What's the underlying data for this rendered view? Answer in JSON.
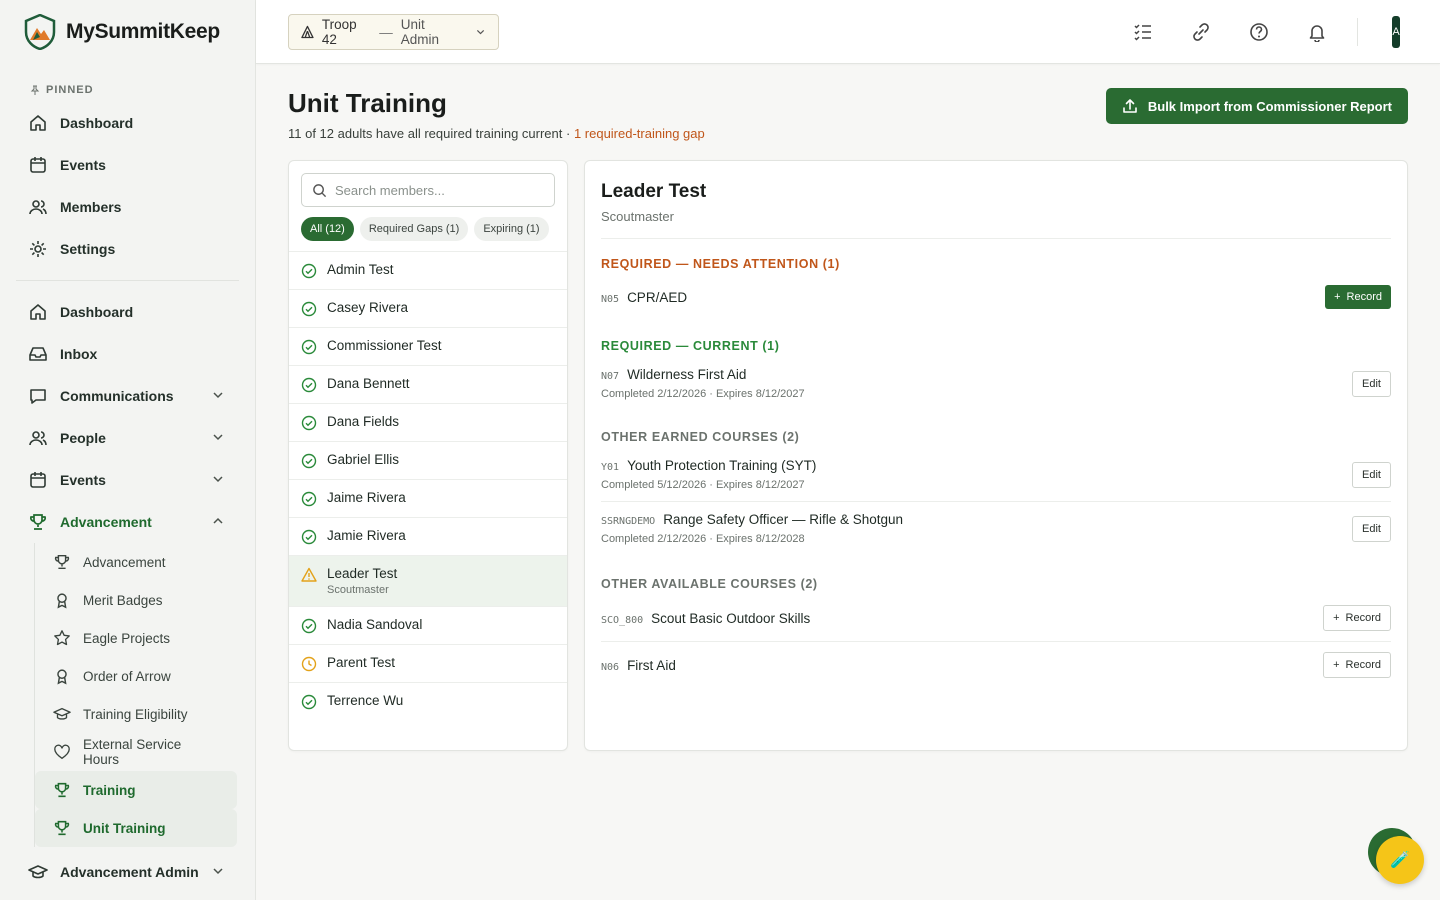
{
  "app": {
    "name": "MySummitKeep"
  },
  "sidebar": {
    "pinned_label": "PINNED",
    "pinned": [
      {
        "label": "Dashboard",
        "icon": "home-icon"
      },
      {
        "label": "Events",
        "icon": "calendar-icon"
      },
      {
        "label": "Members",
        "icon": "people-icon"
      },
      {
        "label": "Settings",
        "icon": "gear-icon"
      }
    ],
    "main": [
      {
        "label": "Dashboard",
        "icon": "home-icon"
      },
      {
        "label": "Inbox",
        "icon": "inbox-icon"
      },
      {
        "label": "Communications",
        "icon": "chat-icon"
      },
      {
        "label": "People",
        "icon": "people-icon"
      },
      {
        "label": "Events",
        "icon": "calendar-icon"
      },
      {
        "label": "Advancement",
        "icon": "trophy-icon"
      }
    ],
    "advancement_sub": [
      {
        "label": "Advancement",
        "icon": "trophy-icon"
      },
      {
        "label": "Merit Badges",
        "icon": "badge-icon"
      },
      {
        "label": "Eagle Projects",
        "icon": "star-icon"
      },
      {
        "label": "Order of Arrow",
        "icon": "badge-icon"
      },
      {
        "label": "Training Eligibility",
        "icon": "grad-cap-icon"
      },
      {
        "label": "External Service Hours",
        "icon": "heart-icon"
      },
      {
        "label": "Training",
        "icon": "trophy-icon"
      },
      {
        "label": "Unit Training",
        "icon": "trophy-icon"
      }
    ],
    "advancement_admin": "Advancement Admin"
  },
  "topbar": {
    "unit": "Troop 42",
    "sep": "—",
    "role": "Unit Admin",
    "avatar": "A"
  },
  "page": {
    "title": "Unit Training",
    "subtitle": "11 of 12 adults have all required training current ·",
    "gap_text": "1 required-training gap",
    "bulk_button": "Bulk Import from Commissioner Report"
  },
  "members": {
    "search_placeholder": "Search members...",
    "chips": [
      "All (12)",
      "Required Gaps (1)",
      "Expiring (1)"
    ],
    "list": [
      {
        "name": "Admin Test",
        "status": "ok"
      },
      {
        "name": "Casey Rivera",
        "status": "ok"
      },
      {
        "name": "Commissioner Test",
        "status": "ok"
      },
      {
        "name": "Dana Bennett",
        "status": "ok"
      },
      {
        "name": "Dana Fields",
        "status": "ok"
      },
      {
        "name": "Gabriel Ellis",
        "status": "ok"
      },
      {
        "name": "Jaime Rivera",
        "status": "ok"
      },
      {
        "name": "Jamie Rivera",
        "status": "ok"
      },
      {
        "name": "Leader Test",
        "role": "Scoutmaster",
        "status": "warn"
      },
      {
        "name": "Nadia Sandoval",
        "status": "ok"
      },
      {
        "name": "Parent Test",
        "status": "expiring"
      },
      {
        "name": "Terrence Wu",
        "status": "ok"
      }
    ]
  },
  "detail": {
    "name": "Leader Test",
    "role": "Scoutmaster",
    "sections": {
      "attention": {
        "heading": "REQUIRED — NEEDS ATTENTION (1)",
        "courses": [
          {
            "code": "N05",
            "title": "CPR/AED",
            "action": "Record"
          }
        ]
      },
      "current": {
        "heading": "REQUIRED — CURRENT (1)",
        "courses": [
          {
            "code": "N07",
            "title": "Wilderness First Aid",
            "meta": "Completed 2/12/2026 · Expires 8/12/2027",
            "action": "Edit"
          }
        ]
      },
      "earned": {
        "heading": "OTHER EARNED COURSES (2)",
        "courses": [
          {
            "code": "Y01",
            "title": "Youth Protection Training (SYT)",
            "meta": "Completed 5/12/2026 · Expires 8/12/2027",
            "action": "Edit"
          },
          {
            "code": "SSRNGDEMO",
            "title": "Range Safety Officer — Rifle & Shotgun",
            "meta": "Completed 2/12/2026 · Expires 8/12/2028",
            "action": "Edit"
          }
        ]
      },
      "available": {
        "heading": "OTHER AVAILABLE COURSES (2)",
        "courses": [
          {
            "code": "SCO_800",
            "title": "Scout Basic Outdoor Skills",
            "action": "Record"
          },
          {
            "code": "N06",
            "title": "First Aid",
            "action": "Record"
          }
        ]
      }
    }
  },
  "colors": {
    "brand_green": "#2a6b32",
    "warn_orange": "#c0561a",
    "ok_green": "#2a8a3a",
    "expiring_amber": "#e3a21a"
  }
}
